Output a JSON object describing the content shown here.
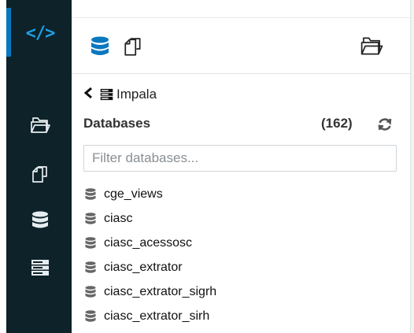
{
  "rail": {
    "items": [
      {
        "name": "editor",
        "icon": "code-icon",
        "label": "</>"
      },
      {
        "name": "files",
        "icon": "folder-open-icon"
      },
      {
        "name": "documents",
        "icon": "documents-icon"
      },
      {
        "name": "tables",
        "icon": "database-icon"
      },
      {
        "name": "servers",
        "icon": "server-icon"
      }
    ]
  },
  "header": {
    "tabs": [
      {
        "name": "sql",
        "icon": "database-icon"
      },
      {
        "name": "documents",
        "icon": "documents-icon"
      }
    ],
    "right_icon": "folder-open-icon"
  },
  "breadcrumb": {
    "back_icon": "chevron-left-icon",
    "source_icon": "server-icon",
    "label": "Impala"
  },
  "databases": {
    "title": "Databases",
    "count": "(162)",
    "refresh_icon": "refresh-icon",
    "filter_placeholder": "Filter databases...",
    "items": [
      "cge_views",
      "ciasc",
      "ciasc_acessosc",
      "ciasc_extrator",
      "ciasc_extrator_sigrh",
      "ciasc_extrator_sirh"
    ]
  },
  "colors": {
    "rail_bg": "#0d2229",
    "accent": "#0a78bf",
    "code_icon": "#1ea0e6"
  }
}
